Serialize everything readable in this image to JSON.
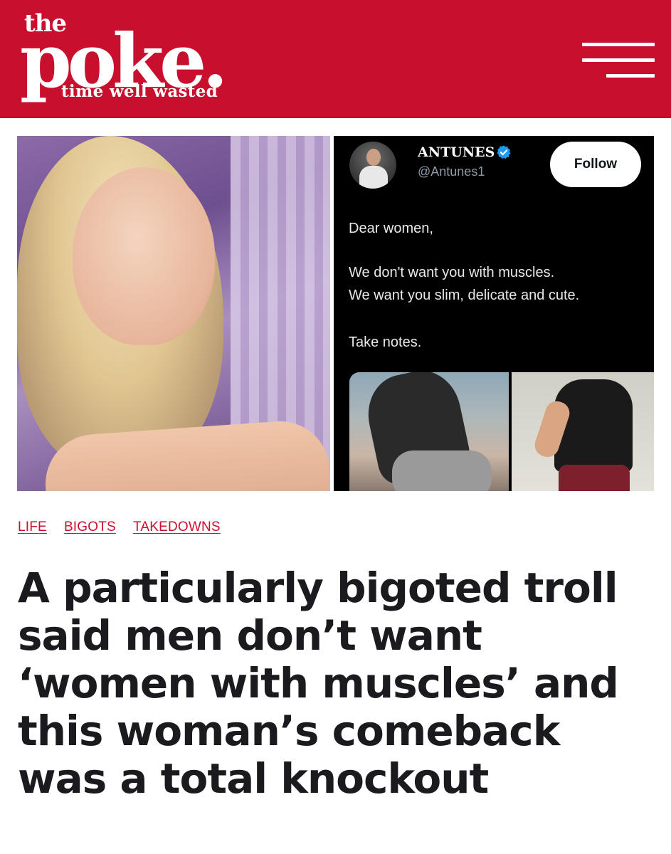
{
  "brand": {
    "the": "the",
    "name": "poke.",
    "tagline": "time well wasted",
    "color": "#c8102e"
  },
  "menu": {
    "icon": "hamburger-menu-icon"
  },
  "tweet": {
    "name": "ANTUNES",
    "handle": "@Antunes1",
    "follow_label": "Follow",
    "verified_icon": "verified-badge-icon",
    "lines": [
      "Dear women,",
      "We don't want you with muscles.",
      "We want you slim, delicate and cute.",
      "Take notes."
    ]
  },
  "tags": [
    "LIFE",
    "BIGOTS",
    "TAKEDOWNS"
  ],
  "headline": {
    "lines": [
      "A particularly bigoted troll",
      "said men don’t want",
      "‘women with muscles’ and",
      "this woman’s comeback",
      "was a total knockout"
    ]
  }
}
